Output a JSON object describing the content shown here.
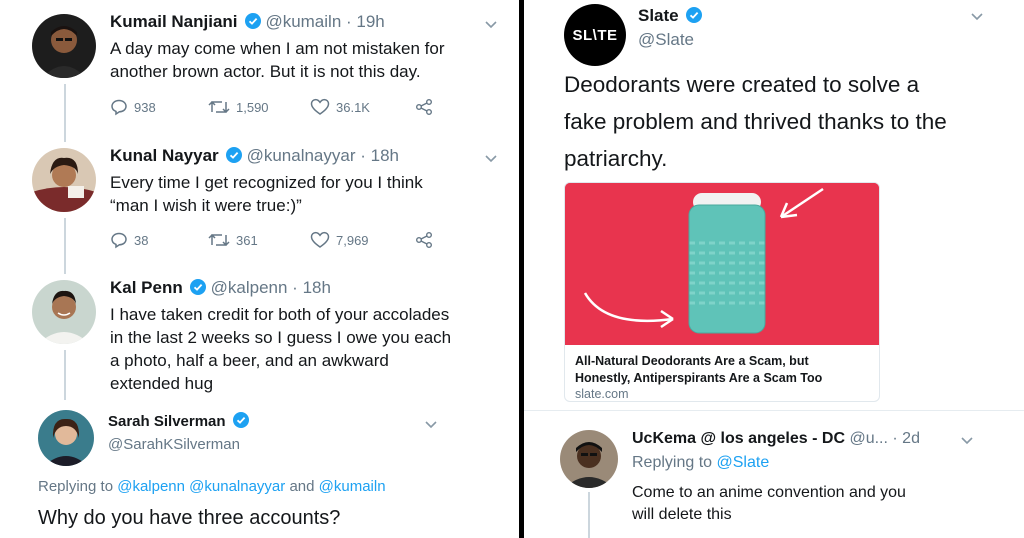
{
  "left": {
    "tweets": [
      {
        "name": "Kumail Nanjiani",
        "handle": "@kumailn · 19h",
        "lines": [
          "A day may come when I am not mistaken for",
          "another brown actor. But it is not this day."
        ],
        "replies": "938",
        "retweets": "1,590",
        "likes": "36.1K"
      },
      {
        "name": "Kunal Nayyar",
        "handle": "@kunalnayyar · 18h",
        "lines": [
          "Every time I get recognized for you I think",
          "“man I wish it were true:)”"
        ],
        "replies": "38",
        "retweets": "361",
        "likes": "7,969"
      },
      {
        "name": "Kal Penn",
        "handle": "@kalpenn · 18h",
        "lines": [
          "I have taken credit for both of your accolades",
          "in the last 2 weeks so I guess I owe you each",
          "a photo, half a beer, and an awkward",
          "extended hug"
        ]
      }
    ],
    "reply": {
      "name": "Sarah Silverman",
      "handle": "@SarahKSilverman",
      "replying_prefix": "Replying to",
      "replying_to": "@kalpenn @kunalnayyar",
      "replying_and": "and",
      "replying_last": "@kumailn",
      "text": "Why do you have three accounts?"
    }
  },
  "right": {
    "tweet": {
      "logo": "SL\\TE",
      "name": "Slate",
      "handle": "@Slate",
      "lines": [
        "Deodorants were created to solve a",
        "fake problem and thrived thanks to the",
        "patriarchy."
      ],
      "card": {
        "title_line1": "All-Natural Deodorants Are a Scam, but",
        "title_line2": "Honestly, Antiperspirants Are a Scam Too",
        "domain": "slate.com"
      }
    },
    "reply": {
      "name": "UcKema @ los angeles - DC",
      "handle": "@u...",
      "time": "· 2d",
      "replying_prefix": "Replying to",
      "replying_to": "@Slate",
      "lines": [
        "Come to an anime convention and you",
        "will delete this"
      ]
    }
  },
  "colors": {
    "verified": "#1da1f2",
    "secondary_text": "#657786",
    "card_background": "#e8344e",
    "deodorant": "#5fc3b8"
  },
  "icons": [
    "verified-badge-icon",
    "chevron-down-icon",
    "reply-icon",
    "retweet-icon",
    "like-icon",
    "share-icon"
  ]
}
